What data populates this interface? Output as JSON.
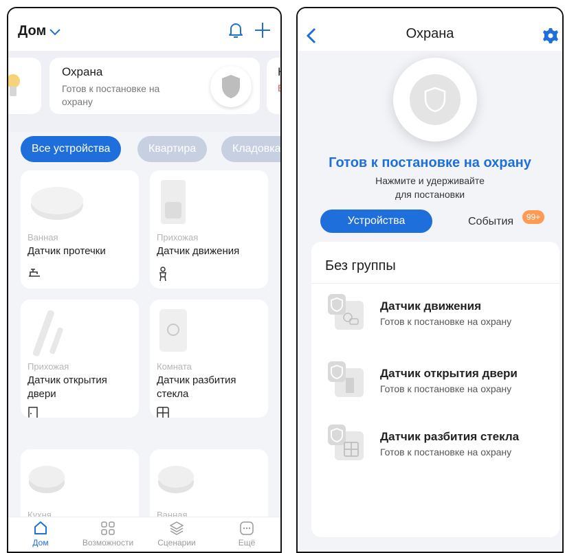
{
  "left": {
    "header": {
      "title": "Дом"
    },
    "carousel": {
      "security_title": "Охрана",
      "security_status": "Готов к постановке на охрану",
      "next_initial": "К",
      "next_status_initial": "В"
    },
    "chips": [
      "Все устройства",
      "Квартира",
      "Кладовка"
    ],
    "devices": [
      {
        "room": "Ванная",
        "name": "Датчик протечки",
        "icon": "faucet-icon"
      },
      {
        "room": "Прихожая",
        "name": "Датчик движения",
        "icon": "person-icon"
      },
      {
        "room": "Прихожая",
        "name": "Датчик открытия двери",
        "icon": "door-icon"
      },
      {
        "room": "Комната",
        "name": "Датчик разбития стекла",
        "icon": "window-icon"
      },
      {
        "room": "Кухня",
        "name": ""
      },
      {
        "room": "Ванная",
        "name": ""
      }
    ],
    "nav": [
      {
        "label": "Дом",
        "icon": "home-icon",
        "active": true
      },
      {
        "label": "Возможности",
        "icon": "grid-icon"
      },
      {
        "label": "Сценарии",
        "icon": "layers-icon"
      },
      {
        "label": "Ещё",
        "icon": "more-icon"
      }
    ]
  },
  "right": {
    "header": {
      "title": "Охрана"
    },
    "status": "Готов к постановке на охрану",
    "hint_line1": "Нажмите и удерживайте",
    "hint_line2": "для постановки",
    "tabs": {
      "devices": "Устройства",
      "events": "События",
      "events_badge": "99+"
    },
    "group_title": "Без группы",
    "items": [
      {
        "name": "Датчик движения",
        "status": "Готов к постановке на охрану"
      },
      {
        "name": "Датчик открытия двери",
        "status": "Готов к постановке на охрану"
      },
      {
        "name": "Датчик разбития стекла",
        "status": "Готов к постановке на охрану"
      }
    ],
    "accent": "#1e6fdb",
    "badge_color": "#ff9a54"
  }
}
